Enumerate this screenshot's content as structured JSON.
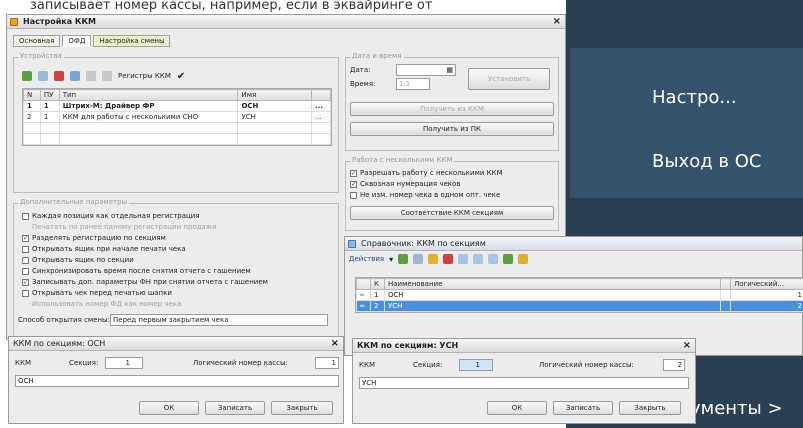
{
  "caption_strip": "записывает номер кассы, например, если в эквайринге от",
  "slides": {
    "tile1": "Настро...",
    "tile2": "Выход в ОС",
    "bottom": "ументы >"
  },
  "main_window": {
    "title": "Настройка ККМ",
    "tabs": [
      "Основная",
      "ОФД",
      "Настройка смены"
    ],
    "devices_group": "Устройства",
    "toolbar_label": "Регистры ККМ",
    "grid": {
      "headers": [
        "N",
        "ПУ",
        "Тип",
        "Имя",
        ""
      ],
      "rows": [
        {
          "n": "1",
          "pu": "1",
          "type": "Штрих-М: Драйвер ФР",
          "name": "ОСН",
          "more": "..."
        },
        {
          "n": "2",
          "pu": "1",
          "type": "ККМ для работы с несколькими СНО",
          "name": "УСН",
          "more": "..."
        }
      ]
    },
    "date_group": "Дата и время",
    "date_label": "Дата:",
    "time_label": "Время:",
    "time_value": "1:1",
    "set_button": "Установить",
    "get_kkm_button": "Получить из ККМ",
    "get_pc_button": "Получить из ПК",
    "multi_group": "Работа с несколькими ККМ",
    "multi_checks": [
      {
        "label": "Разрешать работу с несколькими ККМ",
        "checked": true,
        "muted": false
      },
      {
        "label": "Сквозная нумерация чеков",
        "checked": true,
        "muted": false
      },
      {
        "label": "Не изм. номер чека в одном опт. чеке",
        "checked": false,
        "muted": false
      }
    ],
    "match_button": "Соответствие ККМ секциям",
    "extra_group": "Дополнительные параметры",
    "extra_checks": [
      {
        "label": "Каждая позиция как отдельная регистрация",
        "checked": false,
        "muted": false
      },
      {
        "label": "Печатать по ранее одному регистрации продажи",
        "checked": false,
        "muted": true
      },
      {
        "label": "Разделять регистрацию по секциям",
        "checked": true,
        "muted": false
      },
      {
        "label": "Открывать ящик при начале печати чека",
        "checked": false,
        "muted": false
      },
      {
        "label": "Открывать ящик по секции",
        "checked": false,
        "muted": false
      },
      {
        "label": "Синхронизировать время после снятия отчета с гашением",
        "checked": false,
        "muted": false
      },
      {
        "label": "Записывать доп. параметры ФН при снятии отчета с гашением",
        "checked": true,
        "muted": false
      },
      {
        "label": "Открывать чек перед печатью шапки",
        "checked": false,
        "muted": false
      },
      {
        "label": "Использовать номер ФД как номер чека",
        "checked": false,
        "muted": true
      }
    ],
    "shift_label": "Способ открытия смены:",
    "shift_value": "Перед первым закрытием чека"
  },
  "sections_window": {
    "title": "Справочник: ККМ по секциям",
    "actions_label": "Действия",
    "headers": [
      "",
      "К",
      "Наименование",
      "",
      "Логический..."
    ],
    "rows": [
      {
        "k": "1",
        "name": "ОСН",
        "logic": "1",
        "selected": false
      },
      {
        "k": "2",
        "name": "УСН",
        "logic": "2",
        "selected": true
      }
    ]
  },
  "dialog_osn": {
    "title": "ККМ по секциям: ОСН",
    "kkm_label": "ККМ",
    "section_label": "Секция:",
    "section_value": "1",
    "logical_label": "Логический номер кассы:",
    "logical_value": "1",
    "name_value": "ОСН",
    "ok": "ОК",
    "save": "Записать",
    "close": "Закрыть"
  },
  "dialog_usn": {
    "title": "ККМ по секциям: УСН",
    "kkm_label": "ККМ",
    "section_label": "Секция:",
    "section_value": "1",
    "logical_label": "Логический номер кассы:",
    "logical_value": "2",
    "name_value": "УСН",
    "ok": "ОК",
    "save": "Записать",
    "close": "Закрыть"
  }
}
